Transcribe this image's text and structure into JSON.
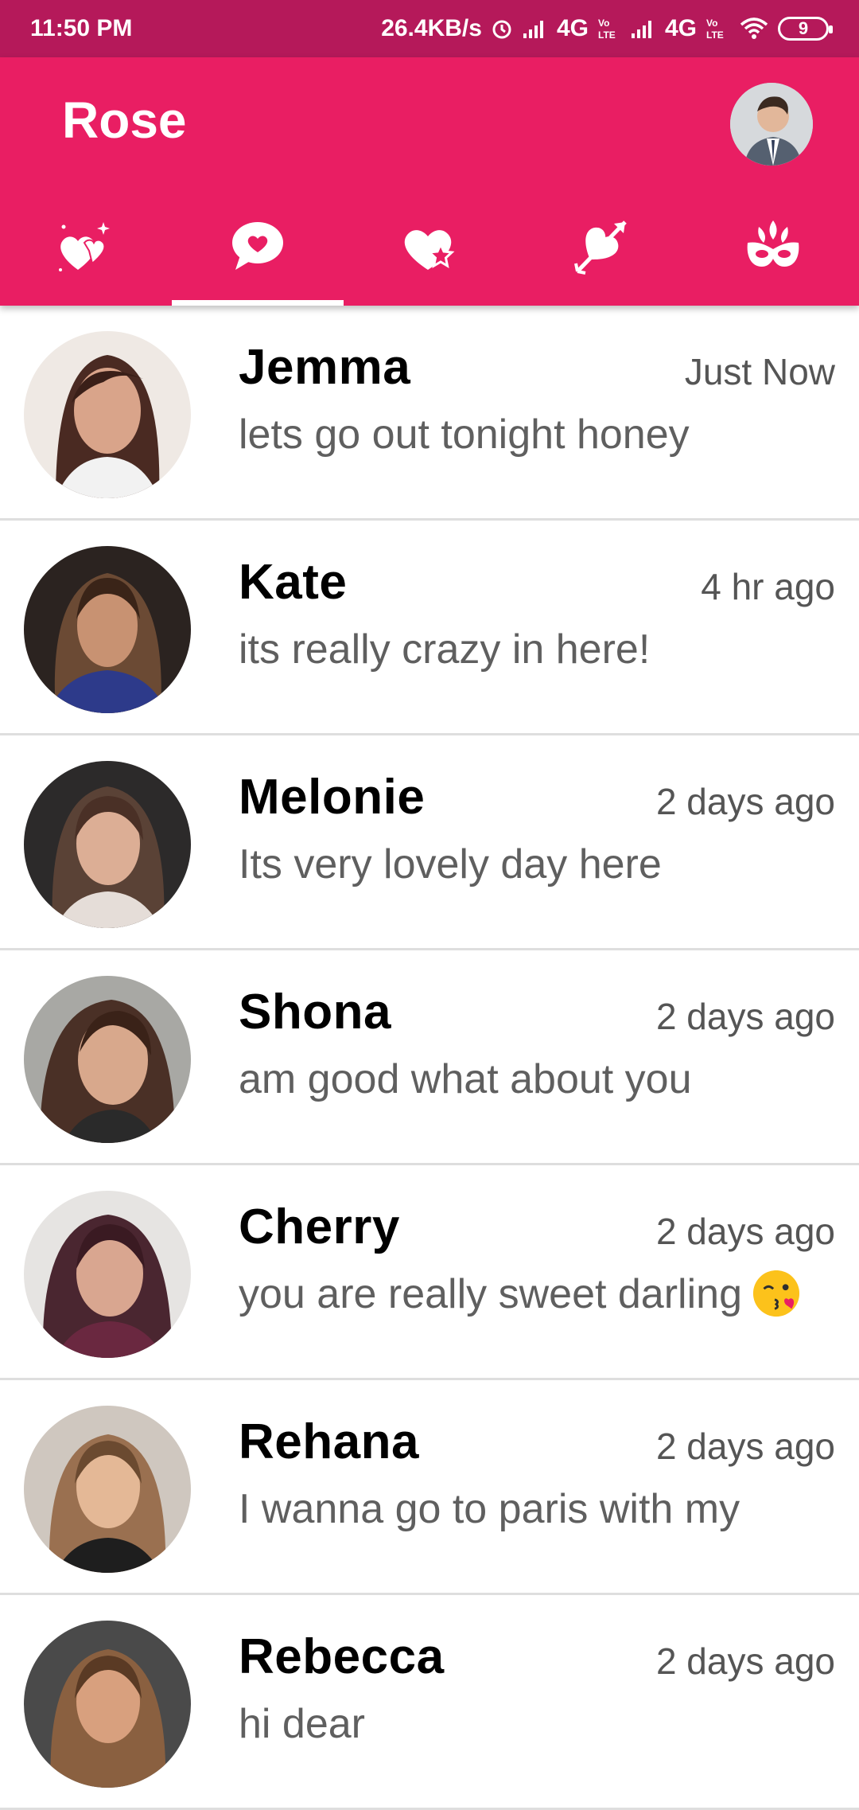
{
  "status_bar": {
    "time": "11:50 PM",
    "speed": "26.4KB/s",
    "network1": "4G",
    "network2": "4G",
    "battery": "9",
    "icons": [
      "alarm-icon",
      "signal-icon",
      "volte-icon",
      "signal-icon",
      "volte-icon",
      "wifi-icon",
      "battery-icon"
    ]
  },
  "header": {
    "title": "Rose",
    "profile_icon": "profile-avatar"
  },
  "tabs": [
    {
      "name": "sparkle-hearts",
      "icon": "sparkle-hearts-icon",
      "active": false
    },
    {
      "name": "chat",
      "icon": "heart-chat-bubble-icon",
      "active": true
    },
    {
      "name": "favorites",
      "icon": "heart-star-icon",
      "active": false
    },
    {
      "name": "cupid",
      "icon": "heart-arrow-icon",
      "active": false
    },
    {
      "name": "masquerade",
      "icon": "mask-icon",
      "active": false
    }
  ],
  "chats": [
    {
      "name": "Jemma",
      "time": "Just Now",
      "message": "lets go out tonight honey",
      "avatar_color": "#b9897a"
    },
    {
      "name": "Kate",
      "time": "4 hr ago",
      "message": "its really crazy in here!",
      "avatar_color": "#6b4a3a"
    },
    {
      "name": "Melonie",
      "time": "2 days ago",
      "message": "Its very lovely day here",
      "avatar_color": "#3e3636"
    },
    {
      "name": "Shona",
      "time": "2 days ago",
      "message": "am good what about you",
      "avatar_color": "#7a5a4e"
    },
    {
      "name": "Cherry",
      "time": "2 days ago",
      "message": "you are really sweet darling",
      "emoji": "kissing-face-emoji",
      "avatar_color": "#6a3a4a"
    },
    {
      "name": "Rehana",
      "time": "2 days ago",
      "message": "I wanna go to paris with my",
      "avatar_color": "#c49a7a"
    },
    {
      "name": "Rebecca",
      "time": "2 days ago",
      "message": "hi dear",
      "avatar_color": "#a57a5a"
    }
  ],
  "colors": {
    "status_bar": "#b5195a",
    "app_bar": "#e91e63",
    "name_text": "#000000",
    "message_text": "#5f5f5f",
    "divider": "#dedede"
  }
}
